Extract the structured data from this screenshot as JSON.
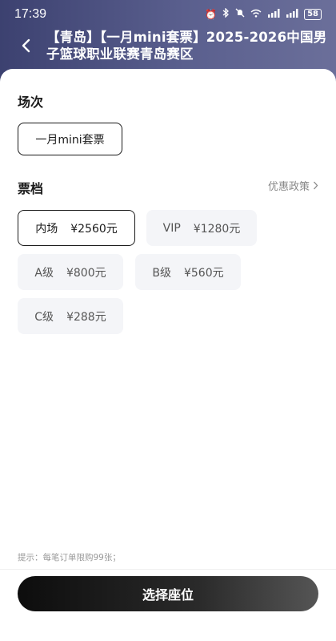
{
  "status_bar": {
    "time": "17:39",
    "battery": "58",
    "icons": [
      "alarm-icon",
      "bluetooth-icon",
      "mute-icon",
      "wifi-icon",
      "signal-icon",
      "signal-icon",
      "battery-icon"
    ]
  },
  "header": {
    "title": "【青岛】【一月mini套票】2025-2026中国男子篮球职业联赛青岛赛区"
  },
  "session": {
    "label": "场次",
    "options": [
      {
        "label": "一月mini套票",
        "selected": true
      }
    ]
  },
  "tickets": {
    "label": "票档",
    "policy_link": "优惠政策",
    "options": [
      {
        "tier": "内场",
        "price": "¥2560元",
        "selected": true
      },
      {
        "tier": "VIP",
        "price": "¥1280元",
        "selected": false
      },
      {
        "tier": "A级",
        "price": "¥800元",
        "selected": false
      },
      {
        "tier": "B级",
        "price": "¥560元",
        "selected": false
      },
      {
        "tier": "C级",
        "price": "¥288元",
        "selected": false
      }
    ]
  },
  "footer": {
    "tip": "提示：每笔订单限购99张；",
    "cta_label": "选择座位"
  },
  "colors": {
    "header_bg": "#4a4e7a",
    "chip_bg": "#f4f5f8",
    "cta_bg": "#1a1a1a"
  }
}
